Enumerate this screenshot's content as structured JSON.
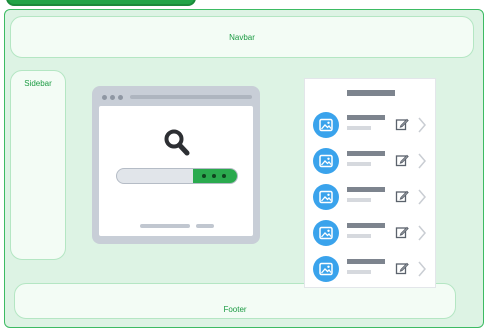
{
  "regions": {
    "navbar": "Navbar",
    "sidebar": "Sidebar",
    "footer": "Footer"
  },
  "icons": {
    "search": "search-icon",
    "image": "image-icon",
    "edit": "edit-icon",
    "chevron": "chevron-right-icon"
  },
  "colors": {
    "frame_bg": "#ddf3e4",
    "accent_green": "#2aaa4e",
    "avatar_blue": "#3aa3ec"
  },
  "list_rows": 5
}
